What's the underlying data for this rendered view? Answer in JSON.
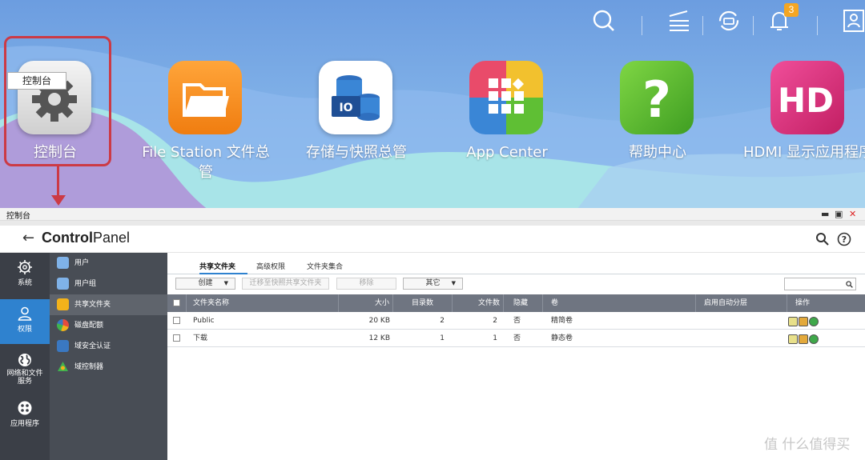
{
  "topbar": {
    "icons": [
      "search-icon",
      "tasks-icon",
      "sync-icon",
      "bell-icon",
      "user-icon"
    ],
    "notification_count": "3"
  },
  "desktop": {
    "tooltip": "控制台",
    "apps": [
      {
        "label": "控制台",
        "icon": "gear-icon",
        "color": "#e6e6e6"
      },
      {
        "label": "File Station 文件总管",
        "icon": "folder-icon",
        "color": "#f5901e"
      },
      {
        "label": "存储与快照总管",
        "icon": "storage-icon",
        "color": "#ffffff"
      },
      {
        "label": "App Center",
        "icon": "app-grid-icon",
        "color": "#e94b6a"
      },
      {
        "label": "帮助中心",
        "icon": "question-icon",
        "color": "#5fbf34"
      },
      {
        "label": "HDMI 显示应用程序",
        "icon": "hd-icon",
        "color": "#e0337f"
      }
    ]
  },
  "window": {
    "title": "控制台",
    "controls": [
      "minimize",
      "maximize",
      "close"
    ]
  },
  "appbar": {
    "title_bold": "Control",
    "title_rest": "Panel",
    "icons": [
      "search-icon",
      "help-icon"
    ]
  },
  "sidebar_main": [
    {
      "label": "系统",
      "icon": "gear-icon",
      "active": false
    },
    {
      "label": "权限",
      "icon": "person-icon",
      "active": true
    },
    {
      "label": "网络和文件服务",
      "icon": "globe-icon",
      "active": false
    },
    {
      "label": "应用程序",
      "icon": "apps-icon",
      "active": false
    }
  ],
  "sidebar_sub": [
    {
      "label": "用户",
      "icon": "user-icon",
      "color": "#4a90d9",
      "active": false
    },
    {
      "label": "用户组",
      "icon": "group-icon",
      "color": "#4a90d9",
      "active": false
    },
    {
      "label": "共享文件夹",
      "icon": "shared-folder-icon",
      "color": "#f3b21a",
      "active": true
    },
    {
      "label": "磁盘配额",
      "icon": "quota-icon",
      "color": "#e74c3c",
      "active": false
    },
    {
      "label": "域安全认证",
      "icon": "domain-icon",
      "color": "#3a78c2",
      "active": false
    },
    {
      "label": "域控制器",
      "icon": "controller-icon",
      "color": "#3fb34f",
      "active": false
    }
  ],
  "tabs": [
    {
      "label": "共享文件夹",
      "active": true
    },
    {
      "label": "高级权限",
      "active": false
    },
    {
      "label": "文件夹集合",
      "active": false
    }
  ],
  "toolbar": {
    "create": "创建",
    "migrate": "迁移至快照共享文件夹",
    "remove": "移除",
    "other": "其它"
  },
  "table": {
    "headers": [
      "文件夹名称",
      "大小",
      "目录数",
      "文件数",
      "隐藏",
      "卷",
      "启用自动分层",
      "操作"
    ],
    "rows": [
      {
        "name": "Public",
        "size": "20 KB",
        "dirs": "2",
        "files": "2",
        "hidden": "否",
        "volume": "精简卷"
      },
      {
        "name": "下载",
        "size": "12 KB",
        "dirs": "1",
        "files": "1",
        "hidden": "否",
        "volume": "静态卷"
      }
    ]
  },
  "watermark": "值 什么值得买"
}
